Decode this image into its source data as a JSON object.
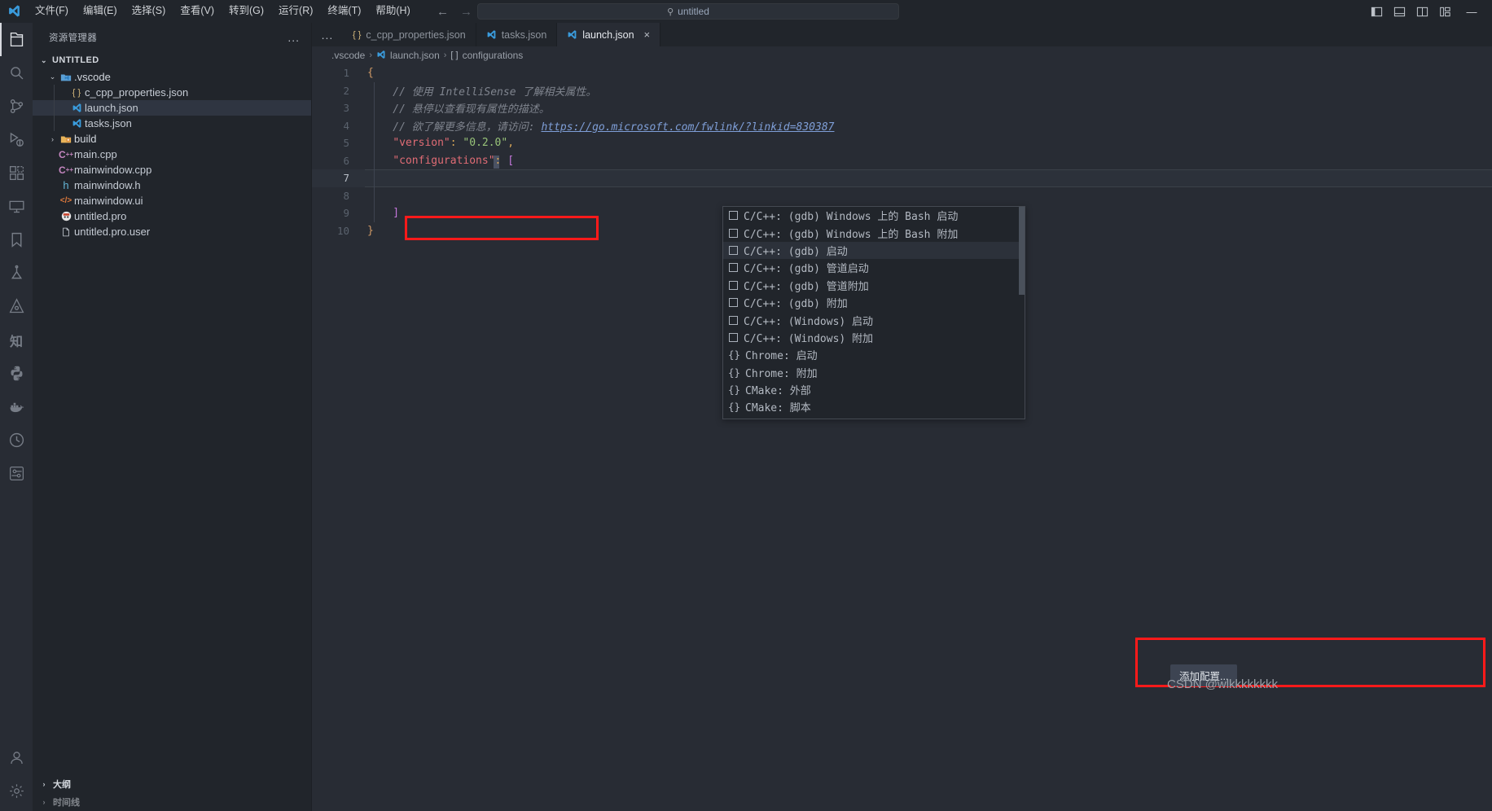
{
  "titlebar": {
    "logo_icon": "vscode-logo-icon",
    "menus": [
      {
        "label": "文件(F)",
        "accel": "F"
      },
      {
        "label": "编辑(E)",
        "accel": "E"
      },
      {
        "label": "选择(S)",
        "accel": "S"
      },
      {
        "label": "查看(V)",
        "accel": "V"
      },
      {
        "label": "转到(G)",
        "accel": "G"
      },
      {
        "label": "运行(R)",
        "accel": "R"
      },
      {
        "label": "终端(T)",
        "accel": "T"
      },
      {
        "label": "帮助(H)",
        "accel": "H"
      }
    ],
    "nav": {
      "back": "←",
      "forward": "→"
    },
    "search": {
      "icon": "search-icon",
      "value": "untitled",
      "placeholder": "untitled"
    },
    "layout_controls": [
      {
        "name": "toggle-primary-sidebar-icon",
        "title": "切换主侧栏"
      },
      {
        "name": "toggle-panel-icon",
        "title": "切换面板"
      },
      {
        "name": "toggle-secondary-sidebar-icon",
        "title": "切换辅助侧栏"
      },
      {
        "name": "customize-layout-icon",
        "title": "自定义布局"
      }
    ],
    "minimize_label": "—"
  },
  "activitybar": {
    "items": [
      {
        "name": "explorer",
        "icon": "files-icon",
        "active": true
      },
      {
        "name": "search",
        "icon": "search-icon",
        "active": false
      },
      {
        "name": "source-control",
        "icon": "source-control-icon",
        "active": false
      },
      {
        "name": "run-and-debug",
        "icon": "run-debug-icon",
        "active": false
      },
      {
        "name": "extensions",
        "icon": "extensions-icon",
        "active": false
      },
      {
        "name": "remote-explorer",
        "icon": "remote-explorer-icon",
        "active": false
      },
      {
        "name": "bookmarks",
        "icon": "bookmark-icon",
        "active": false
      },
      {
        "name": "testing",
        "icon": "testing-beaker-icon",
        "active": false
      },
      {
        "name": "cmake-tools",
        "icon": "cmake-icon",
        "active": false
      },
      {
        "name": "chinese-knowledge",
        "icon": "zhi-icon",
        "glyph": "知",
        "active": false
      },
      {
        "name": "python-env",
        "icon": "python-icon",
        "active": false
      },
      {
        "name": "docker",
        "icon": "docker-icon",
        "active": false
      },
      {
        "name": "clock-history",
        "icon": "clock-icon",
        "active": false
      },
      {
        "name": "settings-gear-alt",
        "icon": "settings-alt-icon",
        "active": false
      }
    ],
    "bottom_items": [
      {
        "name": "accounts",
        "icon": "account-icon"
      },
      {
        "name": "manage-settings",
        "icon": "gear-icon"
      }
    ]
  },
  "sidebar": {
    "title": "资源管理器",
    "more_actions": "...",
    "section": {
      "label": "UNTITLED",
      "expanded": true,
      "chevron": "⌄"
    },
    "tree": [
      {
        "label": ".vscode",
        "type": "folder",
        "icon": "vscode-folder-icon",
        "indent": 1,
        "expanded": true,
        "selected": false
      },
      {
        "label": "c_cpp_properties.json",
        "type": "file",
        "icon": "json-icon",
        "indent": 2,
        "selected": false
      },
      {
        "label": "launch.json",
        "type": "file",
        "icon": "vscode-file-icon",
        "indent": 2,
        "selected": true
      },
      {
        "label": "tasks.json",
        "type": "file",
        "icon": "vscode-file-icon",
        "indent": 2,
        "selected": false
      },
      {
        "label": "build",
        "type": "folder",
        "icon": "build-folder-icon",
        "indent": 1,
        "expanded": false,
        "selected": false
      },
      {
        "label": "main.cpp",
        "type": "file",
        "icon": "cpp-icon",
        "indent": 1,
        "selected": false
      },
      {
        "label": "mainwindow.cpp",
        "type": "file",
        "icon": "cpp-icon",
        "indent": 1,
        "selected": false
      },
      {
        "label": "mainwindow.h",
        "type": "file",
        "icon": "header-icon",
        "indent": 1,
        "selected": false
      },
      {
        "label": "mainwindow.ui",
        "type": "file",
        "icon": "xml-icon",
        "indent": 1,
        "selected": false
      },
      {
        "label": "untitled.pro",
        "type": "file",
        "icon": "qt-icon",
        "indent": 1,
        "selected": false
      },
      {
        "label": "untitled.pro.user",
        "type": "file",
        "icon": "plain-file-icon",
        "indent": 1,
        "selected": false
      }
    ],
    "footer": [
      {
        "label": "大纲",
        "chevron": "›"
      },
      {
        "label": "时间线",
        "chevron": "›"
      }
    ]
  },
  "editor": {
    "tabs_overflow": "...",
    "tabs": [
      {
        "label": "c_cpp_properties.json",
        "icon": "json-icon",
        "active": false,
        "closable": false
      },
      {
        "label": "tasks.json",
        "icon": "vscode-file-icon",
        "active": false,
        "closable": false
      },
      {
        "label": "launch.json",
        "icon": "vscode-file-icon",
        "active": true,
        "closable": true,
        "close": "×"
      }
    ],
    "breadcrumb": [
      {
        "label": ".vscode",
        "icon": null
      },
      {
        "label": "launch.json",
        "icon": "vscode-file-icon"
      },
      {
        "label": "configurations",
        "icon": "array-brackets-icon",
        "prefix": "[ ]"
      }
    ],
    "breadcrumb_separator": "›",
    "lines": [
      {
        "num": "1",
        "segments": [
          {
            "t": "{",
            "c": "c-brace"
          }
        ]
      },
      {
        "num": "2",
        "segments": [
          {
            "t": "    // 使用 IntelliSense 了解相关属性。",
            "c": "c-com"
          }
        ]
      },
      {
        "num": "3",
        "segments": [
          {
            "t": "    // 悬停以查看现有属性的描述。",
            "c": "c-com"
          }
        ]
      },
      {
        "num": "4",
        "segments": [
          {
            "t": "    // 欲了解更多信息，请访问: ",
            "c": "c-com"
          },
          {
            "t": "https://go.microsoft.com/fwlink/?linkid=830387",
            "c": "c-link"
          }
        ]
      },
      {
        "num": "5",
        "segments": [
          {
            "t": "    ",
            "c": ""
          },
          {
            "t": "\"version\"",
            "c": "c-key"
          },
          {
            "t": ": ",
            "c": "c-punct"
          },
          {
            "t": "\"0.2.0\"",
            "c": "c-str"
          },
          {
            "t": ",",
            "c": "c-punct"
          }
        ]
      },
      {
        "num": "6",
        "segments": [
          {
            "t": "    ",
            "c": ""
          },
          {
            "t": "\"configurations\"",
            "c": "c-key"
          },
          {
            "t": ": ",
            "c": "c-punct"
          },
          {
            "t": "[",
            "c": "c-bracket"
          }
        ]
      },
      {
        "num": "7",
        "segments": [],
        "highlighted": true,
        "cursor": true
      },
      {
        "num": "8",
        "segments": []
      },
      {
        "num": "9",
        "segments": [
          {
            "t": "    ]",
            "c": "c-bracket"
          }
        ]
      },
      {
        "num": "10",
        "segments": [
          {
            "t": "}",
            "c": "c-brace"
          }
        ]
      }
    ]
  },
  "suggest": {
    "items": [
      {
        "label": "C/C++: (gdb) Windows 上的 Bash 启动",
        "icon": "checkbox-icon",
        "focused": false
      },
      {
        "label": "C/C++: (gdb) Windows 上的 Bash 附加",
        "icon": "checkbox-icon",
        "focused": false
      },
      {
        "label": "C/C++: (gdb) 启动",
        "icon": "checkbox-icon",
        "focused": true
      },
      {
        "label": "C/C++: (gdb) 管道启动",
        "icon": "checkbox-icon",
        "focused": false
      },
      {
        "label": "C/C++: (gdb) 管道附加",
        "icon": "checkbox-icon",
        "focused": false
      },
      {
        "label": "C/C++: (gdb) 附加",
        "icon": "checkbox-icon",
        "focused": false
      },
      {
        "label": "C/C++: (Windows) 启动",
        "icon": "checkbox-icon",
        "focused": false
      },
      {
        "label": "C/C++: (Windows) 附加",
        "icon": "checkbox-icon",
        "focused": false
      },
      {
        "label": "Chrome: 启动",
        "icon": "braces-icon",
        "braces": "{}",
        "focused": false
      },
      {
        "label": "Chrome: 附加",
        "icon": "braces-icon",
        "braces": "{}",
        "focused": false
      },
      {
        "label": "CMake: 外部",
        "icon": "braces-icon",
        "braces": "{}",
        "focused": false
      },
      {
        "label": "CMake: 脚本",
        "icon": "braces-icon",
        "braces": "{}",
        "focused": false
      }
    ]
  },
  "annotations": {
    "highlight_color": "#ff1a1a",
    "add_config_button": "添加配置...",
    "watermark": "CSDN @wlkkkkkkkk"
  }
}
